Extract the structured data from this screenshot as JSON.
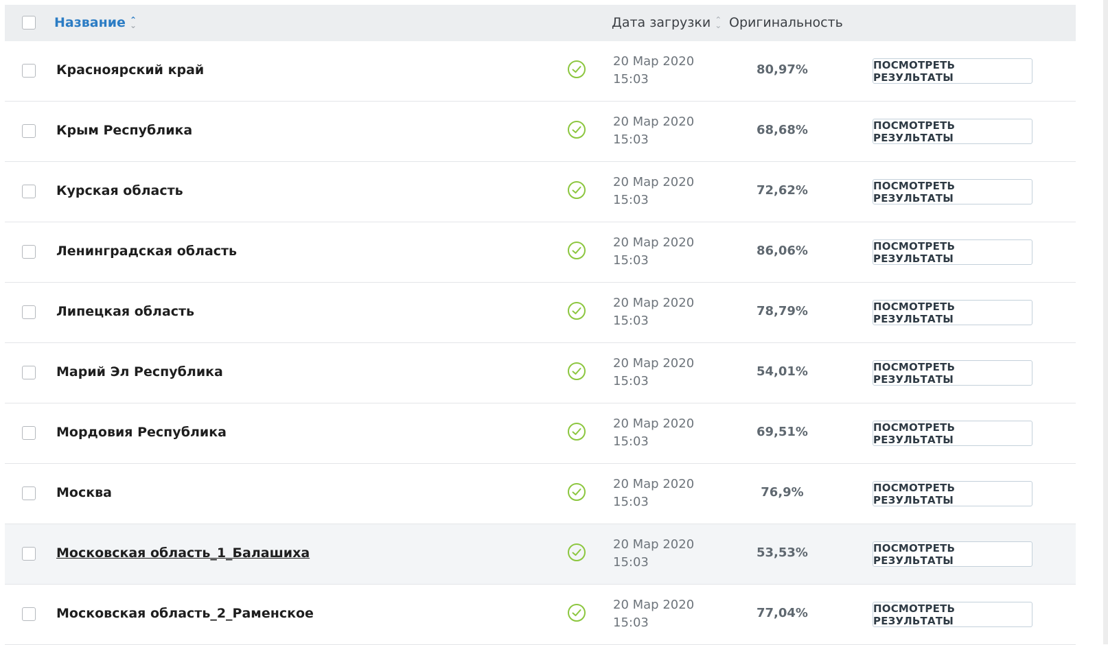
{
  "header": {
    "name_label": "Название",
    "date_label": "Дата загрузки",
    "originality_label": "Оригинальность",
    "sort_up": "⌃",
    "sort_down": "⌄"
  },
  "button_label": "ПОСМОТРЕТЬ РЕЗУЛЬТАТЫ",
  "status_color": "#8cc63f",
  "rows": [
    {
      "name": "Красноярский край",
      "date": "20 Мар 2020",
      "time": "15:03",
      "originality": "80,97%"
    },
    {
      "name": "Крым Республика",
      "date": "20 Мар 2020",
      "time": "15:03",
      "originality": "68,68%"
    },
    {
      "name": "Курская область",
      "date": "20 Мар 2020",
      "time": "15:03",
      "originality": "72,62%"
    },
    {
      "name": "Ленинградская область",
      "date": "20 Мар 2020",
      "time": "15:03",
      "originality": "86,06%"
    },
    {
      "name": "Липецкая область",
      "date": "20 Мар 2020",
      "time": "15:03",
      "originality": "78,79%"
    },
    {
      "name": "Марий Эл Республика",
      "date": "20 Мар 2020",
      "time": "15:03",
      "originality": "54,01%"
    },
    {
      "name": "Мордовия Республика",
      "date": "20 Мар 2020",
      "time": "15:03",
      "originality": "69,51%"
    },
    {
      "name": "Москва",
      "date": "20 Мар 2020",
      "time": "15:03",
      "originality": "76,9%"
    },
    {
      "name": "Московская область_1_Балашиха",
      "date": "20 Мар 2020",
      "time": "15:03",
      "originality": "53,53%"
    },
    {
      "name": "Московская область_2_Раменское",
      "date": "20 Мар 2020",
      "time": "15:03",
      "originality": "77,04%"
    }
  ]
}
